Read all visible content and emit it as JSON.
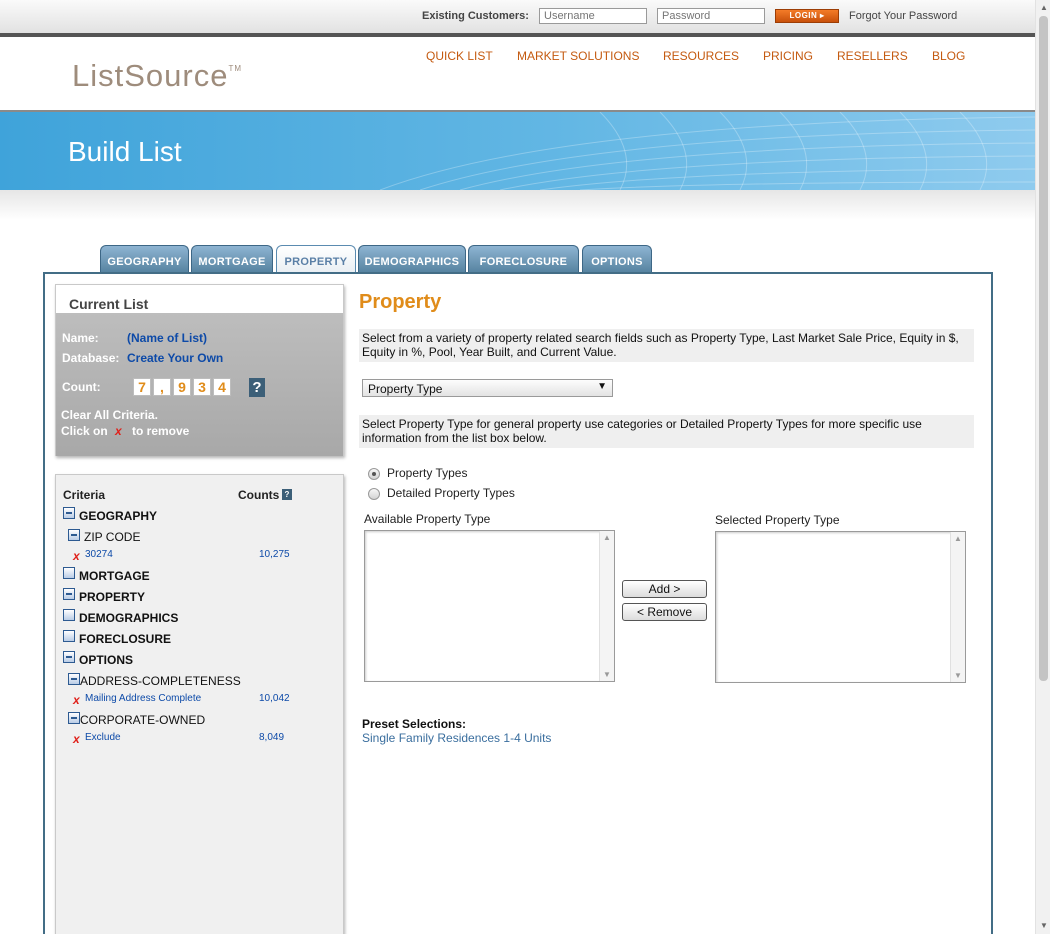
{
  "login": {
    "existing_label": "Existing Customers:",
    "username_placeholder": "Username",
    "password_placeholder": "Password",
    "login_button": "LOGIN ▸",
    "forgot_label": "Forgot Your Password"
  },
  "header": {
    "logo": "ListSource",
    "logo_tm": "TM",
    "nav": [
      "QUICK LIST",
      "MARKET SOLUTIONS",
      "RESOURCES",
      "PRICING",
      "RESELLERS",
      "BLOG"
    ]
  },
  "banner": {
    "title": "Build List"
  },
  "tabs": [
    {
      "label": "GEOGRAPHY",
      "active": false
    },
    {
      "label": "MORTGAGE",
      "active": false
    },
    {
      "label": "PROPERTY",
      "active": true
    },
    {
      "label": "DEMOGRAPHICS",
      "active": false
    },
    {
      "label": "FORECLOSURE",
      "active": false
    },
    {
      "label": "OPTIONS",
      "active": false
    }
  ],
  "current_list": {
    "title": "Current List",
    "name_label": "Name:",
    "name_value": "(Name of List)",
    "database_label": "Database:",
    "database_value": "Create Your Own",
    "count_label": "Count:",
    "count_digits": [
      "7",
      ",",
      "9",
      "3",
      "4"
    ],
    "help": "?",
    "clear_label": "Clear All Criteria.",
    "click_on": "Click on",
    "to_remove": "to remove",
    "x_glyph": "x"
  },
  "criteria": {
    "col_criteria": "Criteria",
    "col_counts": "Counts",
    "help": "?",
    "categories": [
      {
        "label": "GEOGRAPHY",
        "expanded": true
      },
      {
        "label": "MORTGAGE",
        "expanded": false
      },
      {
        "label": "PROPERTY",
        "expanded": true
      },
      {
        "label": "DEMOGRAPHICS",
        "expanded": false
      },
      {
        "label": "FORECLOSURE",
        "expanded": false
      },
      {
        "label": "OPTIONS",
        "expanded": true
      }
    ],
    "subs": [
      "ZIP CODE",
      "ADDRESS-COMPLETENESS",
      "CORPORATE-OWNED"
    ],
    "items": [
      {
        "label": "30274",
        "count": "10,275"
      },
      {
        "label": "Mailing Address Complete",
        "count": "10,042"
      },
      {
        "label": "Exclude",
        "count": "8,049"
      }
    ]
  },
  "property": {
    "title": "Property",
    "desc1": "Select from a variety of property related search fields such as Property Type, Last Market Sale Price, Equity in $, Equity in %, Pool, Year Built, and Current Value.",
    "select_value": "Property Type",
    "desc2": "Select Property Type for general property use categories or Detailed Property Types for more specific use information from the list box below.",
    "radio1": "Property Types",
    "radio2": "Detailed Property Types",
    "radio_selected": 1,
    "available_label": "Available Property Type",
    "selected_label": "Selected Property Type",
    "add_button": "Add >",
    "remove_button": "< Remove",
    "preset_label": "Preset Selections:",
    "preset_link": "Single Family Residences 1-4 Units"
  }
}
